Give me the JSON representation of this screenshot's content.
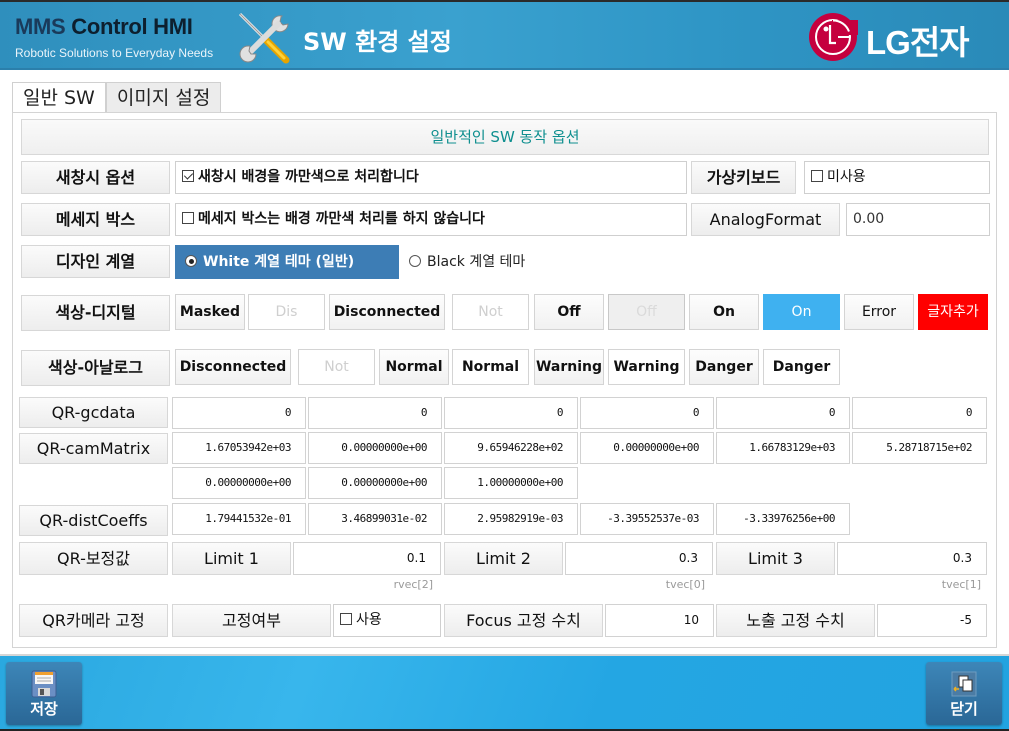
{
  "header": {
    "logo_brand": "MMS",
    "logo_rest": " Control HMI",
    "logo_tagline": "Robotic Solutions to Everyday Needs",
    "tools_icon": "wrench-screwdriver-icon",
    "title": "SW 환경 설정",
    "company": "LG전자"
  },
  "tabs": [
    {
      "label": "일반 SW",
      "active": true
    },
    {
      "label": "이미지 설정",
      "active": false
    }
  ],
  "section_title": "일반적인 SW 동작 옵션",
  "new_window": {
    "label": "새창시 옵션",
    "checkbox_label": "새창시 배경을 까만색으로 처리합니다",
    "checked": true
  },
  "virtual_keyboard": {
    "label": "가상키보드",
    "checkbox_label": "미사용",
    "checked": false
  },
  "message_box": {
    "label": "메세지 박스",
    "checkbox_label": "메세지 박스는 배경 까만색 처리를 하지 않습니다",
    "checked": false
  },
  "analog_format": {
    "label": "AnalogFormat",
    "value": "0.00"
  },
  "design": {
    "label": "디자인 계열",
    "options": [
      {
        "label": "White 계열 테마 (일반)",
        "selected": true
      },
      {
        "label": "Black 계열 테마",
        "selected": false
      }
    ]
  },
  "color_digital": {
    "label": "색상-디지털",
    "swatches": [
      "Masked",
      "Dis",
      "Disconnected",
      "Not",
      "Off",
      "Off",
      "On",
      "On",
      "Error",
      "글자추가"
    ],
    "colors": {
      "on_active": "#3fb1f0",
      "error_text_bg": "#ff0000"
    }
  },
  "color_analog": {
    "label": "색상-아날로그",
    "swatches": [
      "Disconnected",
      "Not",
      "Normal",
      "Normal",
      "Warning",
      "Warning",
      "Danger",
      "Danger"
    ]
  },
  "qr_gcdata": {
    "label": "QR-gcdata",
    "values": [
      "0",
      "0",
      "0",
      "0",
      "0",
      "0"
    ]
  },
  "qr_cam_matrix": {
    "label": "QR-camMatrix",
    "row1": [
      "1.67053942e+03",
      "0.00000000e+00",
      "9.65946228e+02",
      "0.00000000e+00",
      "1.66783129e+03",
      "5.28718715e+02"
    ],
    "row2": [
      "0.00000000e+00",
      "0.00000000e+00",
      "1.00000000e+00"
    ]
  },
  "qr_dist_coeffs": {
    "label": "QR-distCoeffs",
    "values": [
      "1.79441532e-01",
      "3.46899031e-02",
      "2.95982919e-03",
      "-3.39552537e-03",
      "-3.33976256e+00"
    ]
  },
  "qr_correction": {
    "label": "QR-보정값",
    "limits": [
      {
        "label": "Limit 1",
        "value": "0.1",
        "hint": "rvec[2]"
      },
      {
        "label": "Limit 2",
        "value": "0.3",
        "hint": "tvec[0]"
      },
      {
        "label": "Limit 3",
        "value": "0.3",
        "hint": "tvec[1]"
      }
    ]
  },
  "qr_camera_fix": {
    "label": "QR카메라 고정",
    "fix_label": "고정여부",
    "fix_checkbox": "사용",
    "fix_checked": false,
    "focus_label": "Focus 고정 수치",
    "focus_value": "10",
    "exposure_label": "노출 고정 수치",
    "exposure_value": "-5"
  },
  "footer": {
    "save_label": "저장",
    "save_icon": "floppy-disk-icon",
    "close_label": "닫기",
    "close_icon": "exit-windows-icon"
  }
}
